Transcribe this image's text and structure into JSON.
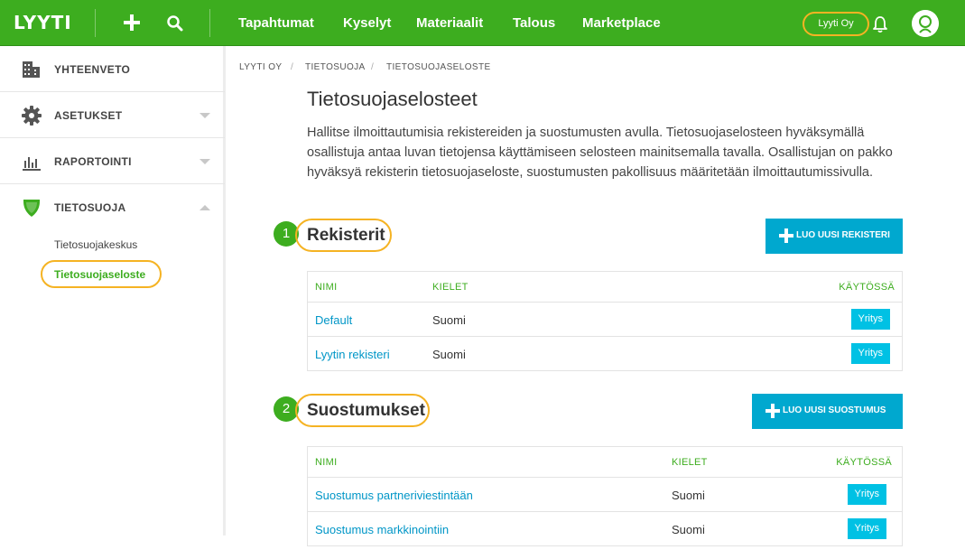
{
  "header": {
    "logo": "LYYTI",
    "nav": [
      "Tapahtumat",
      "Kyselyt",
      "Materiaalit",
      "Talous",
      "Marketplace"
    ],
    "org": "Lyyti Oy"
  },
  "sidebar": {
    "items": [
      {
        "label": "YHTEENVETO"
      },
      {
        "label": "ASETUKSET"
      },
      {
        "label": "RAPORTOINTI"
      },
      {
        "label": "TIETOSUOJA"
      }
    ],
    "sub_items": [
      {
        "label": "Tietosuojakeskus"
      },
      {
        "label": "Tietosuojaseloste"
      }
    ]
  },
  "breadcrumb": [
    "LYYTI OY",
    "TIETOSUOJA",
    "TIETOSUOJASELOSTE"
  ],
  "page": {
    "title": "Tietosuojaselosteet",
    "intro": "Hallitse ilmoittautumisia rekistereiden ja suostumusten avulla. Tietosuojaselosteen hyväksymällä osallistuja antaa luvan tietojensa käyttämiseen selosteen mainitsemalla tavalla. Osallistujan on pakko hyväksyä rekisterin tietosuojaseloste, suostumusten pakollisuus määritetään ilmoittautumissivulla."
  },
  "registers": {
    "step": "1",
    "title": "Rekisterit",
    "button": "LUO UUSI REKISTERI",
    "columns": [
      "NIMI",
      "KIELET",
      "KÄYTÖSSÄ"
    ],
    "rows": [
      {
        "name": "Default",
        "lang": "Suomi",
        "usage": "Yritys"
      },
      {
        "name": "Lyytin rekisteri",
        "lang": "Suomi",
        "usage": "Yritys"
      }
    ]
  },
  "consents": {
    "step": "2",
    "title": "Suostumukset",
    "button": "LUO UUSI SUOSTUMUS",
    "columns": [
      "NIMI",
      "KIELET",
      "KÄYTÖSSÄ"
    ],
    "rows": [
      {
        "name": "Suostumus partneriviestintään",
        "lang": "Suomi",
        "usage": "Yritys"
      },
      {
        "name": "Suostumus markkinointiin",
        "lang": "Suomi",
        "usage": "Yritys"
      }
    ]
  },
  "colors": {
    "brand_green": "#3dad1f",
    "highlight_outline": "#f5b323",
    "cta_blue": "#00a8cf",
    "tag_blue": "#00c1e4",
    "link_blue": "#0096c7"
  },
  "icons": [
    "plus-icon",
    "search-icon",
    "bell-icon",
    "user-avatar-icon",
    "building-icon",
    "gear-icon",
    "bar-chart-icon",
    "shield-icon"
  ]
}
